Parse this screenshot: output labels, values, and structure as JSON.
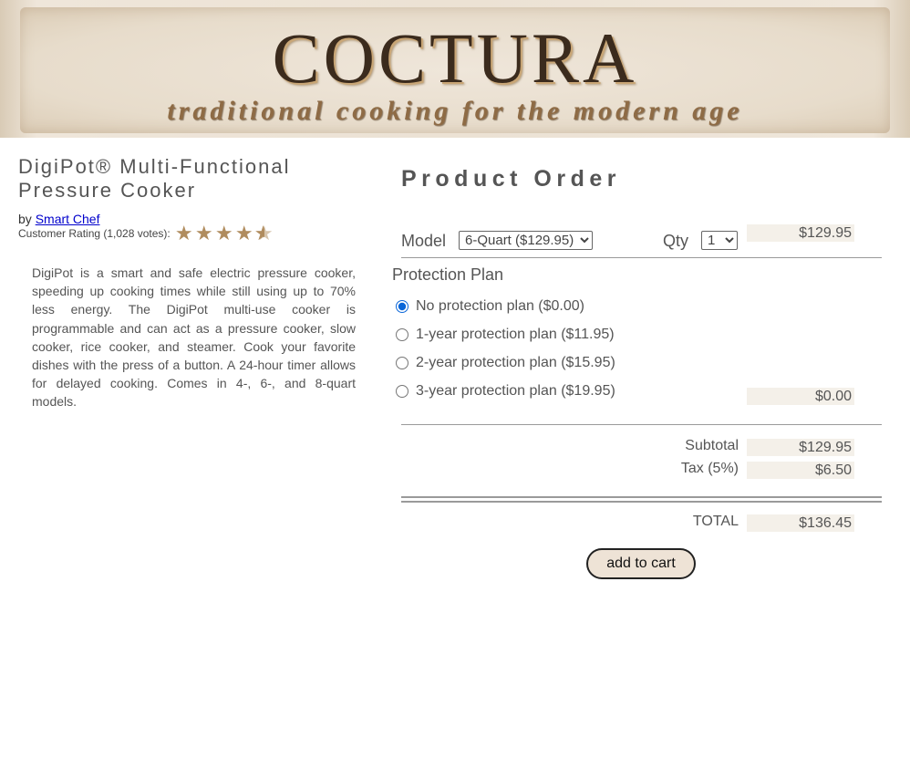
{
  "banner": {
    "title": "COCTURA",
    "tagline": "traditional cooking for the modern age"
  },
  "product": {
    "title": "DigiPot® Multi-Functional Pressure Cooker",
    "by_prefix": "by",
    "brand": "Smart Chef",
    "rating_label": "Customer Rating (1,028 votes):",
    "rating_stars": 4.5,
    "rating_max": 5,
    "description": "DigiPot is a smart and safe electric pressure cooker, speeding up cooking times while still using up to 70% less energy. The DigiPot multi-use cooker is programmable and can act as a pressure cooker, slow cooker, rice cooker, and steamer. Cook your favorite dishes with the press of a button. A 24-hour timer allows for delayed cooking. Comes in 4-, 6-, and 8-quart models."
  },
  "order": {
    "heading": "Product Order",
    "model_label": "Model",
    "model_selected": "6-Quart ($129.95)",
    "qty_label": "Qty",
    "qty_selected": "1",
    "model_amount": "$129.95",
    "plan_heading": "Protection Plan",
    "plans": [
      {
        "label": "No protection plan ($0.00)",
        "checked": true
      },
      {
        "label": "1-year protection plan ($11.95)",
        "checked": false
      },
      {
        "label": "2-year protection plan ($15.95)",
        "checked": false
      },
      {
        "label": "3-year protection plan ($19.95)",
        "checked": false
      }
    ],
    "plan_amount": "$0.00",
    "subtotal_label": "Subtotal",
    "subtotal": "$129.95",
    "tax_label": "Tax (5%)",
    "tax": "$6.50",
    "total_label": "TOTAL",
    "total": "$136.45",
    "add_to_cart": "add to cart"
  },
  "colors": {
    "accent_star": "#b08c5e",
    "amount_bg": "#f4f0e9",
    "button_bg": "#eee3d6",
    "link": "#0000cc",
    "radio_selected": "#0a66d8"
  }
}
